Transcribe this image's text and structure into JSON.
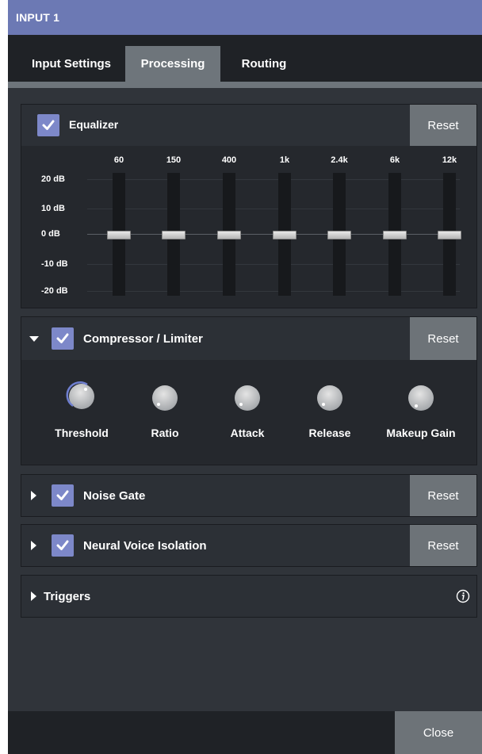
{
  "window": {
    "title": "INPUT 1"
  },
  "tabs": [
    {
      "label": "Input Settings",
      "active": false
    },
    {
      "label": "Processing",
      "active": true
    },
    {
      "label": "Routing",
      "active": false
    }
  ],
  "equalizer": {
    "label": "Equalizer",
    "enabled": true,
    "reset_label": "Reset",
    "bands": [
      {
        "freq": "60",
        "gain_db": 0
      },
      {
        "freq": "150",
        "gain_db": 0
      },
      {
        "freq": "400",
        "gain_db": 0
      },
      {
        "freq": "1k",
        "gain_db": 0
      },
      {
        "freq": "2.4k",
        "gain_db": 0
      },
      {
        "freq": "6k",
        "gain_db": 0
      },
      {
        "freq": "12k",
        "gain_db": 0
      }
    ],
    "db_scale": [
      "20 dB",
      "10 dB",
      "0 dB",
      "-10 dB",
      "-20 dB"
    ],
    "range_db": [
      -20,
      20
    ]
  },
  "compressor": {
    "label": "Compressor / Limiter",
    "enabled": true,
    "expanded": true,
    "reset_label": "Reset",
    "knobs": [
      {
        "label": "Threshold"
      },
      {
        "label": "Ratio"
      },
      {
        "label": "Attack"
      },
      {
        "label": "Release"
      },
      {
        "label": "Makeup Gain"
      }
    ]
  },
  "noise_gate": {
    "label": "Noise Gate",
    "enabled": true,
    "expanded": false,
    "reset_label": "Reset"
  },
  "voice_isolation": {
    "label": "Neural Voice Isolation",
    "enabled": true,
    "expanded": false,
    "reset_label": "Reset"
  },
  "triggers": {
    "label": "Triggers",
    "expanded": false,
    "info_icon": "info-icon"
  },
  "footer": {
    "close_label": "Close"
  },
  "colors": {
    "title_bar": "#6c79b4",
    "checkbox": "#7d88c9",
    "button": "#6d7378",
    "panel": "#25282d"
  }
}
